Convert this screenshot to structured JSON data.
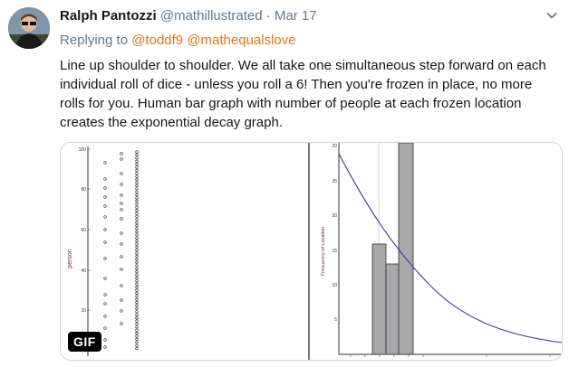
{
  "tweet": {
    "author_name": "Ralph Pantozzi",
    "handle": "@mathillustrated",
    "separator": "·",
    "date": "Mar 17",
    "reply_prefix": "Replying to",
    "reply_to": [
      "@toddf9",
      "@mathequalslove"
    ],
    "text": "Line up shoulder to shoulder. We all take one simultaneous step forward on each individual roll of dice - unless you roll a 6! Then you're frozen in place, no more rolls for you. Human bar graph with number of people at each frozen location creates the exponential decay graph.",
    "accent_color": "#e0761e",
    "icons": [
      "avatar",
      "chevron-down-icon"
    ]
  },
  "media": {
    "badge": "GIF",
    "left_panel": {
      "ylabel": "person",
      "yticks": [
        "100",
        "80",
        "60",
        "40",
        "20"
      ]
    },
    "right_panel": {
      "ylabel": "Frequency of Location",
      "yticks": [
        "20",
        "25",
        "20",
        "15",
        "10",
        "5"
      ]
    }
  },
  "chart_data": [
    {
      "type": "scatter",
      "ylabel": "person",
      "ylim": [
        0,
        100
      ],
      "yticks": [
        20,
        40,
        60,
        80,
        100
      ],
      "note_columns": "people at frozen locations 0,1,2,3"
    },
    {
      "type": "bar",
      "ylabel": "Frequency of Location",
      "ylim": [
        0,
        30
      ],
      "values": [
        16,
        13,
        30
      ],
      "curve": "exponential decay"
    }
  ]
}
